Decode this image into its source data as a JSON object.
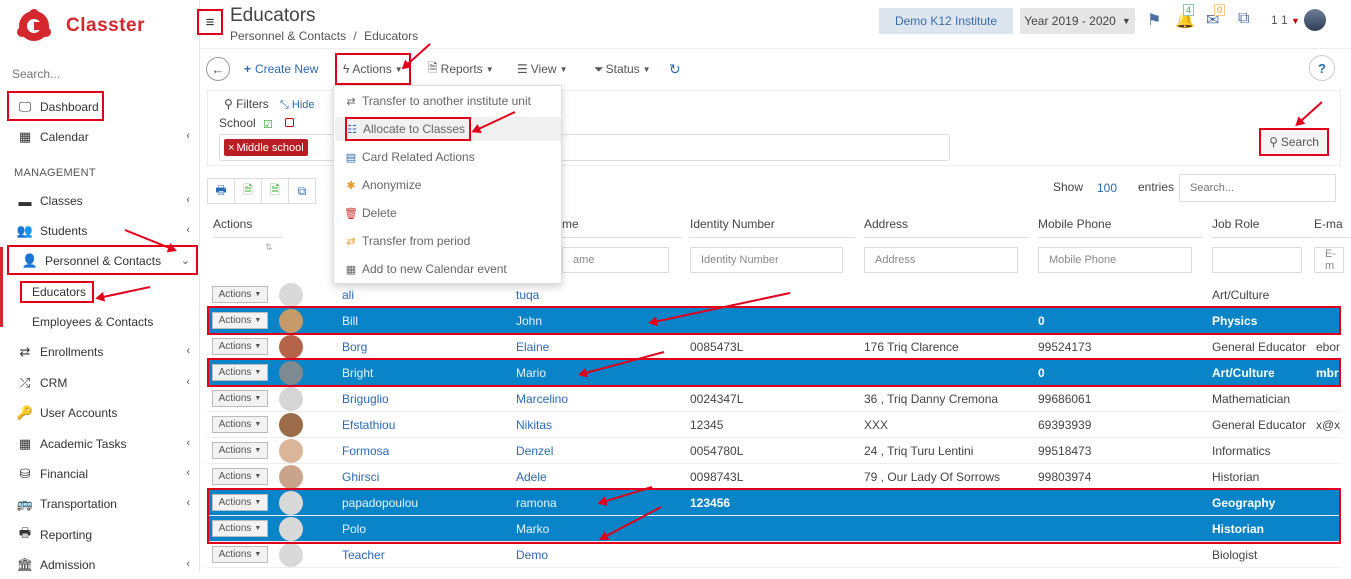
{
  "app": {
    "name": "Classter"
  },
  "sidebar": {
    "search_placeholder": "Search...",
    "section": "MANAGEMENT",
    "items": [
      {
        "label": "Dashboard",
        "icon": "monitor-icon"
      },
      {
        "label": "Calendar",
        "icon": "calendar-icon"
      },
      {
        "label": "Classes",
        "icon": "classes-icon"
      },
      {
        "label": "Students",
        "icon": "students-icon"
      },
      {
        "label": "Personnel & Contacts",
        "icon": "person-icon"
      },
      {
        "label": "Enrollments",
        "icon": "arrows-icon"
      },
      {
        "label": "CRM",
        "icon": "crm-icon"
      },
      {
        "label": "User Accounts",
        "icon": "key-icon"
      },
      {
        "label": "Academic Tasks",
        "icon": "grid-icon"
      },
      {
        "label": "Financial",
        "icon": "coins-icon"
      },
      {
        "label": "Transportation",
        "icon": "bus-icon"
      },
      {
        "label": "Reporting",
        "icon": "printer-icon"
      },
      {
        "label": "Admission",
        "icon": "bank-icon"
      }
    ],
    "sub": [
      "Educators",
      "Employees & Contacts"
    ]
  },
  "header": {
    "title": "Educators",
    "breadcrumb": [
      "Personnel & Contacts",
      "/",
      "Educators"
    ],
    "institute": "Demo K12 Institute",
    "year": "Year 2019 - 2020",
    "notif_count": "4",
    "mail_count": "0",
    "user_label": "1 1"
  },
  "toolbar": {
    "create": "Create New",
    "actions": "Actions",
    "reports": "Reports",
    "view": "View",
    "status": "Status",
    "help": "?"
  },
  "filters": {
    "title": "Filters",
    "hide": "Hide",
    "school_label": "School",
    "tag": "Middle school",
    "search": "Search"
  },
  "table_ctrl": {
    "show": "Show",
    "count": "100",
    "entries": "entries",
    "search_placeholder": "Search..."
  },
  "dropdown": [
    {
      "label": "Transfer to another institute unit",
      "icon": "transfer-icon"
    },
    {
      "label": "Allocate to Classes",
      "icon": "list-icon"
    },
    {
      "label": "Card Related Actions",
      "icon": "card-icon"
    },
    {
      "label": "Anonymize",
      "icon": "asterisk-icon"
    },
    {
      "label": "Delete",
      "icon": "trash-icon"
    },
    {
      "label": "Transfer from period",
      "icon": "transfer-period-icon"
    },
    {
      "label": "Add to new Calendar event",
      "icon": "calendar-add-icon"
    }
  ],
  "table": {
    "headers": [
      "Actions",
      "me",
      "Identity Number",
      "Address",
      "Mobile Phone",
      "Job Role",
      "E-ma"
    ],
    "filter_placeholders": [
      "ame",
      "Identity Number",
      "Address",
      "Mobile Phone",
      "",
      "E-m"
    ],
    "action_label": "Actions",
    "rows": [
      {
        "last": "ali",
        "first": "tuqa",
        "id": "",
        "address": "",
        "mobile": "",
        "role": "Art/Culture",
        "email": "",
        "selected": false
      },
      {
        "last": "Bill",
        "first": "John",
        "id": "",
        "address": "",
        "mobile": "0",
        "role": "Physics",
        "email": "",
        "selected": true
      },
      {
        "last": "Borg",
        "first": "Elaine",
        "id": "0085473L",
        "address": "176 Triq Clarence",
        "mobile": "99524173",
        "role": "General Educator",
        "email": "ebor",
        "selected": false
      },
      {
        "last": "Bright",
        "first": "Mario",
        "id": "",
        "address": "",
        "mobile": "0",
        "role": "Art/Culture",
        "email": "mbr",
        "selected": true
      },
      {
        "last": "Briguglio",
        "first": "Marcelino",
        "id": "0024347L",
        "address": "36 , Triq Danny Cremona",
        "mobile": "99686061",
        "role": "Mathematician",
        "email": "",
        "selected": false
      },
      {
        "last": "Efstathiou",
        "first": "Nikitas",
        "id": "12345",
        "address": "XXX",
        "mobile": "69393939",
        "role": "General Educator",
        "email": "x@x.",
        "selected": false
      },
      {
        "last": "Formosa",
        "first": "Denzel",
        "id": "0054780L",
        "address": "24 , Triq Turu Lentini",
        "mobile": "99518473",
        "role": "Informatics",
        "email": "",
        "selected": false
      },
      {
        "last": "Ghirsci",
        "first": "Adele",
        "id": "0098743L",
        "address": "79 , Our Lady Of Sorrows",
        "mobile": "99803974",
        "role": "Historian",
        "email": "",
        "selected": false
      },
      {
        "last": "papadopoulou",
        "first": "ramona",
        "id": "123456",
        "address": "",
        "mobile": "",
        "role": "Geography",
        "email": "",
        "selected": true
      },
      {
        "last": "Polo",
        "first": "Marko",
        "id": "",
        "address": "",
        "mobile": "",
        "role": "Historian",
        "email": "",
        "selected": true
      },
      {
        "last": "Teacher",
        "first": "Demo",
        "id": "",
        "address": "",
        "mobile": "",
        "role": "Biologist",
        "email": "",
        "selected": false
      }
    ]
  },
  "colors": {
    "brand": "#d4272e",
    "highlight": "#e0001b",
    "selected_row": "#0a84c8",
    "link": "#2a6bb5"
  }
}
